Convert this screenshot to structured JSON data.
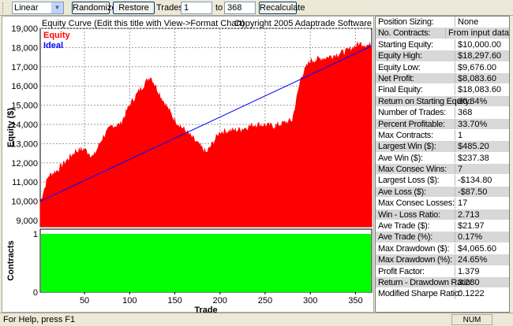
{
  "toolbar": {
    "scale_select": "Linear",
    "randomize": "Randomize",
    "restore": "Restore",
    "trades_label": "Trades:",
    "trades_from": "1",
    "to_label": "to",
    "trades_to": "368",
    "recalculate": "Recalculate"
  },
  "chart_data": [
    {
      "type": "area",
      "title": "Equity Curve (Edit this title with View->Format Chart)",
      "copyright": "Copyright 2005 Adaptrade Software",
      "ylabel": "Equity ($)",
      "xlabel": "Trade",
      "ylim": [
        9000,
        19000
      ],
      "xlim": [
        1,
        368
      ],
      "yticks": [
        "19,000",
        "18,000",
        "17,000",
        "16,000",
        "15,000",
        "14,000",
        "13,000",
        "12,000",
        "11,000",
        "10,000",
        "9,000"
      ],
      "xticks": [
        "50",
        "100",
        "150",
        "200",
        "250",
        "300",
        "350"
      ],
      "legend": [
        {
          "name": "Equity",
          "color": "#ff0000"
        },
        {
          "name": "Ideal",
          "color": "#0000ff"
        }
      ],
      "equity_keypoints": [
        [
          1,
          9950
        ],
        [
          10,
          11300
        ],
        [
          20,
          11600
        ],
        [
          30,
          12100
        ],
        [
          40,
          12600
        ],
        [
          50,
          12700
        ],
        [
          60,
          12300
        ],
        [
          70,
          13300
        ],
        [
          80,
          13900
        ],
        [
          90,
          14000
        ],
        [
          100,
          15000
        ],
        [
          110,
          15700
        ],
        [
          123,
          16500
        ],
        [
          135,
          15400
        ],
        [
          150,
          14200
        ],
        [
          165,
          13500
        ],
        [
          185,
          12500
        ],
        [
          200,
          13600
        ],
        [
          220,
          13700
        ],
        [
          240,
          14000
        ],
        [
          260,
          13900
        ],
        [
          280,
          14200
        ],
        [
          290,
          16500
        ],
        [
          300,
          17300
        ],
        [
          320,
          17500
        ],
        [
          340,
          17800
        ],
        [
          355,
          18200
        ],
        [
          368,
          18083
        ]
      ],
      "ideal": [
        [
          1,
          10000
        ],
        [
          368,
          18083
        ]
      ]
    },
    {
      "type": "area",
      "ylabel": "Contracts",
      "ylim": [
        0,
        1
      ],
      "yticks": [
        "1",
        "0"
      ],
      "value": 1,
      "color": "#00ff00"
    }
  ],
  "stats": [
    [
      "Position Sizing:",
      "None"
    ],
    [
      "No. Contracts:",
      "From input data"
    ],
    [
      "Starting Equity:",
      "$10,000.00"
    ],
    [
      "Equity High:",
      "$18,297.60"
    ],
    [
      "Equity Low:",
      "$9,676.00"
    ],
    [
      "Net Profit:",
      "$8,083.60"
    ],
    [
      "Final Equity:",
      "$18,083.60"
    ],
    [
      "Return on Starting Equity:",
      "80.84%"
    ],
    [
      "Number of Trades:",
      "368"
    ],
    [
      "Percent Profitable:",
      "33.70%"
    ],
    [
      "Max Contracts:",
      "1"
    ],
    [
      "Largest Win ($):",
      "$485.20"
    ],
    [
      "Ave Win ($):",
      "$237.38"
    ],
    [
      "Max Consec Wins:",
      "7"
    ],
    [
      "Largest Loss ($):",
      "-$134.80"
    ],
    [
      "Ave Loss ($):",
      "-$87.50"
    ],
    [
      "Max Consec Losses:",
      "17"
    ],
    [
      "Win - Loss Ratio:",
      "2.713"
    ],
    [
      "Ave Trade ($):",
      "$21.97"
    ],
    [
      "Ave Trade (%):",
      "0.17%"
    ],
    [
      "Max Drawdown ($):",
      "$4,065.60"
    ],
    [
      "Max Drawdown (%):",
      "24.65%"
    ],
    [
      "Profit Factor:",
      "1.379"
    ],
    [
      "Return - Drawdown Ratio:",
      "3.280"
    ],
    [
      "Modified Sharpe Ratio:",
      "0.1222"
    ]
  ],
  "status": {
    "help": "For Help, press F1",
    "num": "NUM"
  }
}
